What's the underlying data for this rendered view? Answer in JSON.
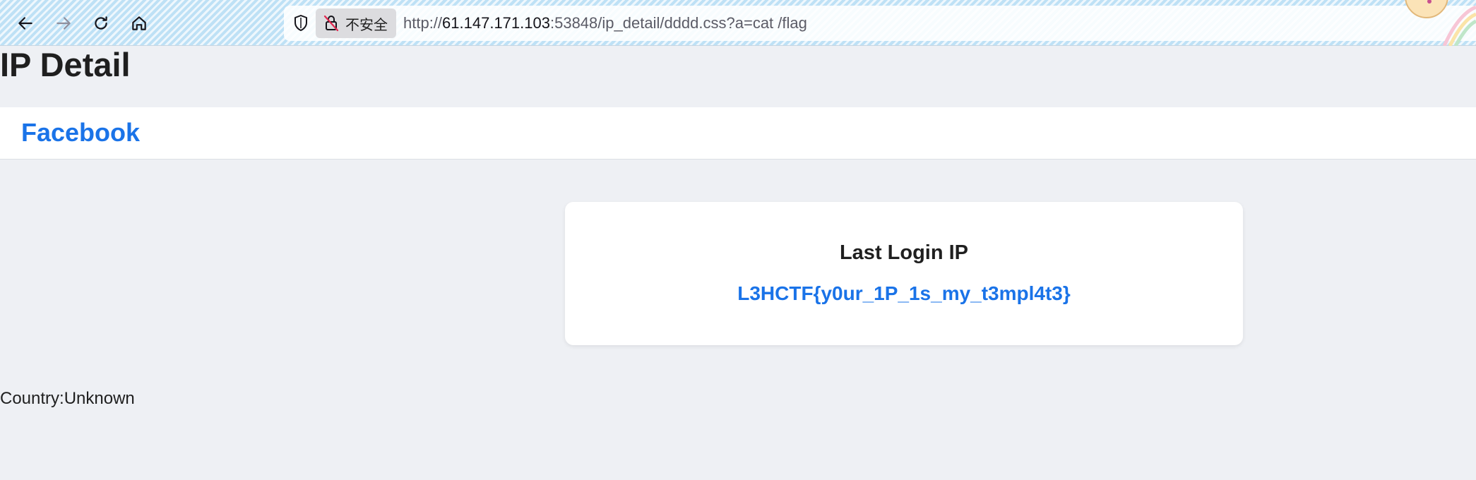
{
  "browser": {
    "security_label": "不安全",
    "url": {
      "scheme": "http://",
      "host": "61.147.171.103",
      "rest": ":53848/ip_detail/dddd.css?a=cat /flag"
    }
  },
  "page": {
    "title": "IP Detail",
    "brand": "Facebook",
    "card": {
      "title": "Last Login IP",
      "value": "L3HCTF{y0ur_1P_1s_my_t3mpl4t3}"
    },
    "country": "Country:Unknown"
  },
  "colors": {
    "accent": "#1a73e8",
    "page_background": "#eef0f4",
    "card_background": "#ffffff"
  }
}
